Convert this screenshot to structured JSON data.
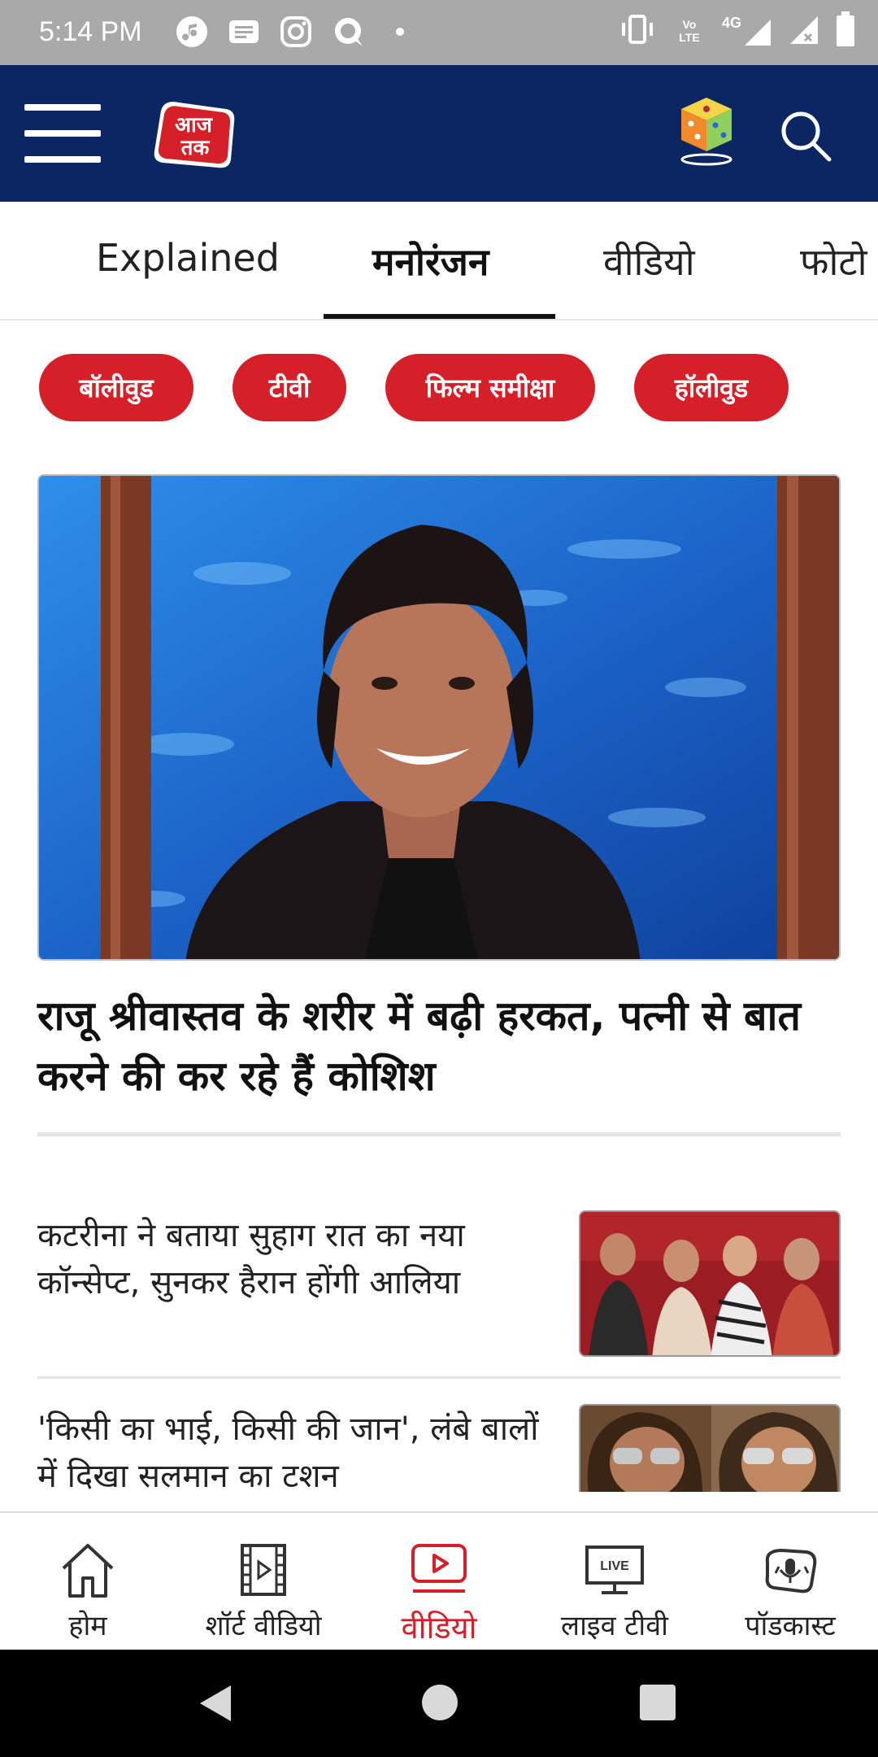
{
  "status": {
    "time": "5:14 PM",
    "network": "4G",
    "volte": "Vo LTE"
  },
  "header": {
    "logo_text": "आज तक"
  },
  "tabs": [
    {
      "label": "Explained"
    },
    {
      "label": "मनोरंजन",
      "active": true
    },
    {
      "label": "वीडियो"
    },
    {
      "label": "फोटो"
    }
  ],
  "chips": [
    {
      "label": "बॉलीवुड"
    },
    {
      "label": "टीवी"
    },
    {
      "label": "फिल्म समीक्षा"
    },
    {
      "label": "हॉलीवुड"
    }
  ],
  "hero": {
    "title": "राजू श्रीवास्तव के शरीर में बढ़ी हरकत, पत्नी से बात करने की कर रहे हैं कोशिश"
  },
  "articles": [
    {
      "title": "कटरीना ने बताया सुहाग रात का नया कॉन्सेप्ट, सुनकर हैरान होंगी आलिया"
    },
    {
      "title": "'किसी का भाई, किसी की जान', लंबे बालों में दिखा सलमान का टशन"
    }
  ],
  "bottom_nav": [
    {
      "label": "होम",
      "icon": "home-icon"
    },
    {
      "label": "शॉर्ट वीडियो",
      "icon": "short-video-icon"
    },
    {
      "label": "वीडियो",
      "icon": "video-icon",
      "active": true
    },
    {
      "label": "लाइव टीवी",
      "icon": "live-tv-icon",
      "badge": "LIVE"
    },
    {
      "label": "पॉडकास्ट",
      "icon": "podcast-icon"
    }
  ],
  "colors": {
    "header_bg": "#0b2662",
    "accent": "#d5202a",
    "status_bg": "#a9a9a9"
  }
}
